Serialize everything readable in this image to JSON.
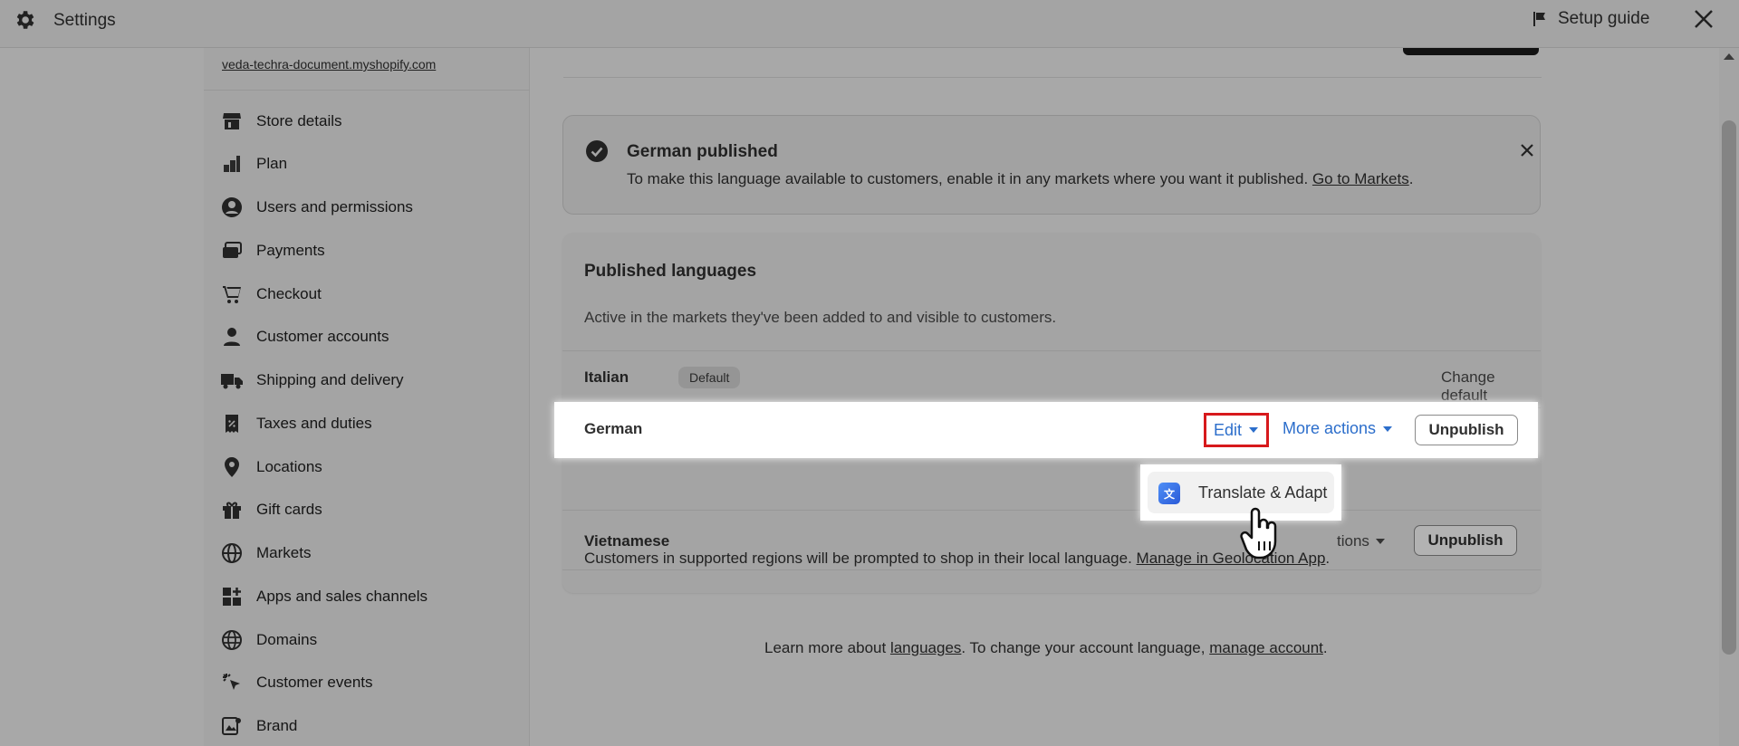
{
  "topbar": {
    "title": "Settings",
    "setup_guide": "Setup guide",
    "icons": {
      "settings": "gear-icon",
      "setup": "flag-icon",
      "close": "close-icon"
    }
  },
  "sidebar": {
    "store_url": "veda-techra-document.myshopify.com",
    "items": [
      {
        "label": "Store details",
        "icon": "store-icon"
      },
      {
        "label": "Plan",
        "icon": "plan-icon"
      },
      {
        "label": "Users and permissions",
        "icon": "user-circle-icon"
      },
      {
        "label": "Payments",
        "icon": "payments-icon"
      },
      {
        "label": "Checkout",
        "icon": "cart-icon"
      },
      {
        "label": "Customer accounts",
        "icon": "person-icon"
      },
      {
        "label": "Shipping and delivery",
        "icon": "truck-icon"
      },
      {
        "label": "Taxes and duties",
        "icon": "tax-icon"
      },
      {
        "label": "Locations",
        "icon": "location-pin-icon"
      },
      {
        "label": "Gift cards",
        "icon": "gift-icon"
      },
      {
        "label": "Markets",
        "icon": "globe-icon"
      },
      {
        "label": "Apps and sales channels",
        "icon": "apps-icon"
      },
      {
        "label": "Domains",
        "icon": "domain-globe-icon"
      },
      {
        "label": "Customer events",
        "icon": "cursor-click-icon"
      },
      {
        "label": "Brand",
        "icon": "brand-icon"
      }
    ]
  },
  "banner": {
    "title": "German published",
    "text": "To make this language available to customers, enable it in any markets where you want it published.",
    "link": "Go to Markets",
    "link_suffix": "."
  },
  "published_languages": {
    "title": "Published languages",
    "subtitle": "Active in the markets they've been added to and visible to customers.",
    "rows": [
      {
        "language": "Italian",
        "badge": "Default",
        "action": "Change default"
      },
      {
        "language": "German",
        "edit": "Edit",
        "more_actions": "More actions",
        "unpublish": "Unpublish"
      },
      {
        "language": "Vietnamese",
        "more_actions_partial": "tions",
        "unpublish": "Unpublish"
      }
    ],
    "footer_text": "Customers in supported regions will be prompted to shop in their local language.",
    "footer_link": "Manage in Geolocation App",
    "footer_suffix": "."
  },
  "dropdown": {
    "item_label": "Translate & Adapt",
    "item_icon": "translate-app-icon"
  },
  "learn_more": {
    "prefix": "Learn more about",
    "link1": "languages",
    "middle": ". To change your account language,",
    "link2": "manage account",
    "suffix": "."
  },
  "colors": {
    "link_blue": "#2c6ecb",
    "highlight_red": "#d7191c",
    "overlay": "rgba(0,0,0,0.30)"
  }
}
